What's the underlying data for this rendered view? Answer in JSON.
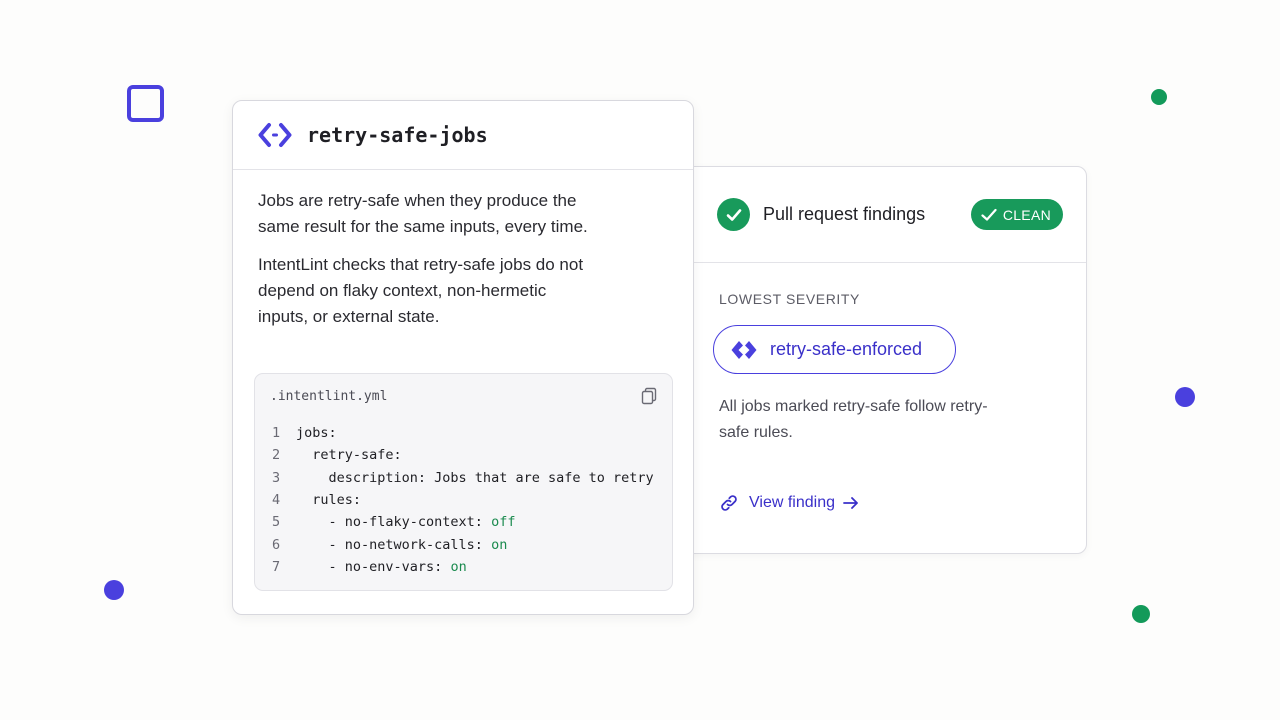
{
  "rule_card": {
    "title": "retry-safe-jobs",
    "paragraphs": [
      "Jobs are retry-safe when they produce the same result for the same inputs, every time.",
      "IntentLint checks that retry-safe jobs do not depend on flaky context, non-hermetic inputs, or external state."
    ],
    "code": {
      "filename": ".intentlint.yml",
      "lines": [
        {
          "num": "1",
          "text": "jobs:",
          "value": ""
        },
        {
          "num": "2",
          "text": "  retry-safe:",
          "value": ""
        },
        {
          "num": "3",
          "text": "    description: Jobs that are safe to retry",
          "value": ""
        },
        {
          "num": "4",
          "text": "  rules:",
          "value": ""
        },
        {
          "num": "5",
          "text": "    - no-flaky-context: ",
          "value": "off"
        },
        {
          "num": "6",
          "text": "    - no-network-calls: ",
          "value": "on"
        },
        {
          "num": "7",
          "text": "    - no-env-vars: ",
          "value": "on"
        }
      ]
    }
  },
  "findings_card": {
    "title": "Pull request findings",
    "badge": "CLEAN",
    "severity_label": "LOWEST SEVERITY",
    "rule_name": "retry-safe-enforced",
    "description": "All jobs marked retry-safe follow retry-safe rules.",
    "link_label": "View finding"
  },
  "colors": {
    "accent": "#4a40de",
    "success": "#189a5b",
    "code_value": "#1a8a4e"
  },
  "icons": {
    "rule_header": "code-brackets-icon",
    "findings_status": "check-circle-icon",
    "rule_pill": "diamond-arrows-icon",
    "copy": "copy-icon",
    "link": "link-icon",
    "arrow": "arrow-right-icon"
  }
}
